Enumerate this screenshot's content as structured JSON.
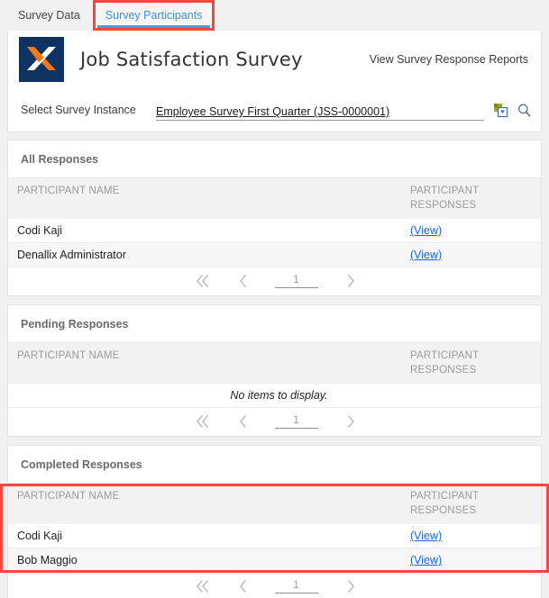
{
  "tabs": [
    {
      "label": "Survey Data",
      "active": false
    },
    {
      "label": "Survey Participants",
      "active": true
    }
  ],
  "header": {
    "logo_icon": "x-logo-icon",
    "title": "Job Satisfaction Survey",
    "action_label": "View Survey Response Reports",
    "logo_colors": {
      "background": "#0e3360",
      "orange": "#f07818",
      "white": "#ffffff"
    }
  },
  "select_instance": {
    "label": "Select Survey Instance",
    "value": "Employee Survey First Quarter (JSS-0000001)",
    "filter_icon": "filter-dropdown-icon",
    "search_icon": "search-icon"
  },
  "columns": {
    "name": "PARTICIPANT NAME",
    "responses": "PARTICIPANT RESPONSES"
  },
  "pager": {
    "first_icon": "double-chevron-left-icon",
    "prev_icon": "chevron-left-icon",
    "next_icon": "chevron-right-icon",
    "page_value": "1"
  },
  "sections": [
    {
      "id": "all-responses",
      "title": "All Responses",
      "rows": [
        {
          "name": "Codi Kaji",
          "response": "(View)"
        },
        {
          "name": "Denallix Administrator",
          "response": "(View)"
        }
      ],
      "empty_text": "",
      "highlighted": false
    },
    {
      "id": "pending-responses",
      "title": "Pending Responses",
      "rows": [],
      "empty_text": "No items to display.",
      "highlighted": false
    },
    {
      "id": "completed-responses",
      "title": "Completed Responses",
      "rows": [
        {
          "name": "Codi Kaji",
          "response": "(View)"
        },
        {
          "name": "Bob Maggio",
          "response": "(View)"
        }
      ],
      "empty_text": "",
      "highlighted": true
    }
  ],
  "annotation": {
    "highlight_color": "#f8463f"
  }
}
